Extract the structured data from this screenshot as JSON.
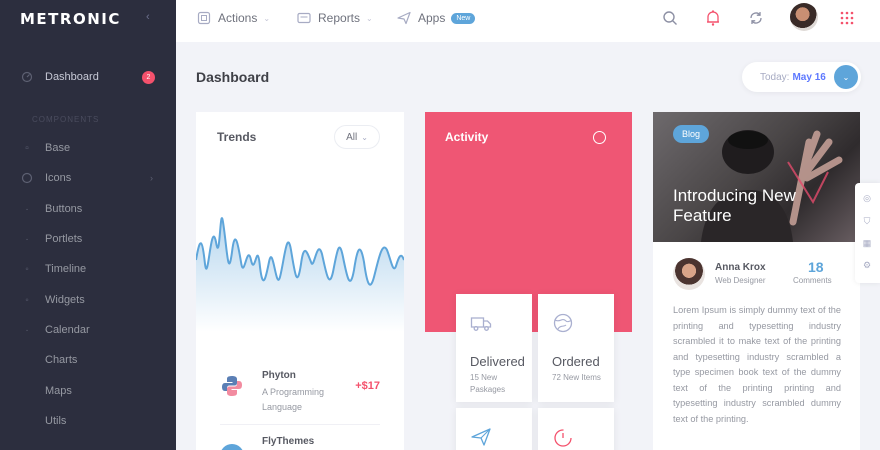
{
  "brand": {
    "name": "METRONIC"
  },
  "sidebar": {
    "section_label": "COMPONENTS",
    "items": [
      {
        "label": "Dashboard",
        "icon": "dashboard-icon",
        "badge": "2",
        "active": true
      },
      {
        "label": "Base",
        "icon": "layers-icon"
      },
      {
        "label": "Icons",
        "icon": "icons-icon",
        "has_arrow": true
      },
      {
        "label": "Buttons",
        "icon": "button-icon"
      },
      {
        "label": "Portlets",
        "icon": "portlet-icon"
      },
      {
        "label": "Timeline",
        "icon": "timeline-icon"
      },
      {
        "label": "Widgets",
        "icon": "widgets-icon"
      },
      {
        "label": "Calendar",
        "icon": "calendar-icon"
      },
      {
        "label": "Charts",
        "icon": "chart-icon"
      },
      {
        "label": "Maps",
        "icon": "map-icon"
      },
      {
        "label": "Utils",
        "icon": "utils-icon"
      }
    ]
  },
  "header": {
    "menu": [
      {
        "label": "Actions",
        "icon": "actions-icon"
      },
      {
        "label": "Reports",
        "icon": "reports-icon"
      },
      {
        "label": "Apps",
        "icon": "apps-icon",
        "badge": "New"
      }
    ]
  },
  "subheader": {
    "title": "Dashboard",
    "date_prefix": "Today:",
    "date_value": "May 16"
  },
  "trends": {
    "title": "Trends",
    "filter": "All",
    "items": [
      {
        "name": "Phyton",
        "desc": "A Programming Language",
        "amount": "+$17"
      },
      {
        "name": "FlyThemes",
        "desc": "",
        "amount": ""
      }
    ]
  },
  "activity": {
    "title": "Activity",
    "tiles": [
      {
        "title": "Delivered",
        "sub": "15 New Paskages",
        "icon": "truck-icon"
      },
      {
        "title": "Ordered",
        "sub": "72 New Items",
        "icon": "globe-icon"
      },
      {
        "title": "",
        "sub": "",
        "icon": "paper-plane-icon"
      },
      {
        "title": "",
        "sub": "",
        "icon": "timer-icon"
      }
    ]
  },
  "blog": {
    "badge": "Blog",
    "title": "Introducing New Feature",
    "author": "Anna Krox",
    "role": "Web Designer",
    "comments_count": "18",
    "comments_label": "Comments",
    "text": "Lorem Ipsum is simply dummy text of the printing and typesetting industry scrambled it to make text of the printing and typesetting industry scrambled a type specimen book text of the dummy text of the printing printing and typesetting industry scrambled dummy text of the printing."
  },
  "colors": {
    "sidebar_bg": "#2c2e3e",
    "accent_pink": "#ef5674",
    "accent_blue": "#5ea5da",
    "danger": "#f4516c"
  }
}
